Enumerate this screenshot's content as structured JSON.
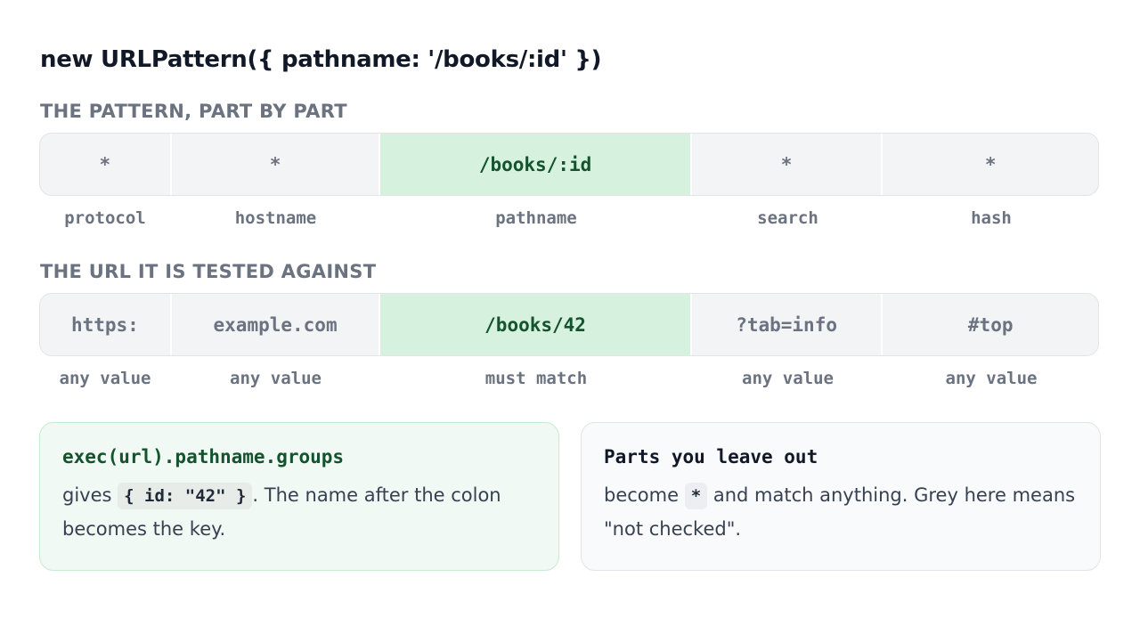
{
  "title": "new URLPattern({ pathname: '/books/:id' })",
  "pattern_section": {
    "label": "THE PATTERN, PART BY PART",
    "cells": [
      {
        "value": "*",
        "caption": "protocol"
      },
      {
        "value": "*",
        "caption": "hostname"
      },
      {
        "value": "/books/:id",
        "caption": "pathname"
      },
      {
        "value": "*",
        "caption": "search"
      },
      {
        "value": "*",
        "caption": "hash"
      }
    ]
  },
  "url_section": {
    "label": "THE URL IT IS TESTED AGAINST",
    "cells": [
      {
        "value": "https:",
        "caption": "any value"
      },
      {
        "value": "example.com",
        "caption": "any value"
      },
      {
        "value": "/books/42",
        "caption": "must match"
      },
      {
        "value": "?tab=info",
        "caption": "any value"
      },
      {
        "value": "#top",
        "caption": "any value"
      }
    ]
  },
  "cards": {
    "groups": {
      "heading": "exec(url).pathname.groups",
      "text_before": "gives",
      "code": "{ id: \"42\" }",
      "text_after": ". The name after the colon becomes the key."
    },
    "omit": {
      "heading": "Parts you leave out",
      "text_before": "become",
      "code": "*",
      "text_after": "and match anything. Grey here means \"not checked\"."
    }
  },
  "colors": {
    "highlight_fill": "#d7f1df",
    "highlight_text": "#14532d",
    "muted_fill": "#f3f4f6",
    "muted_text": "#6b7280"
  }
}
